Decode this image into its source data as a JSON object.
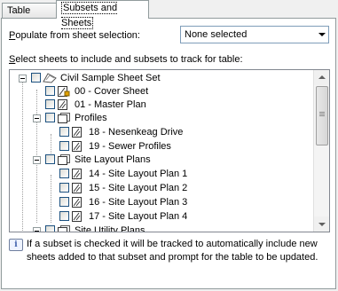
{
  "tabs": [
    {
      "label": "Table Data",
      "active": false
    },
    {
      "label": "Subsets and Sheets",
      "active": true
    }
  ],
  "populate": {
    "label_accel": "P",
    "label_rest": "opulate from sheet selection:",
    "value": "None selected"
  },
  "select": {
    "label_accel": "S",
    "label_rest": "elect sheets to include and subsets to track for table:"
  },
  "tree": {
    "root": "Civil Sample Sheet Set",
    "items": [
      {
        "label": "00 - Cover Sheet"
      },
      {
        "label": "01 - Master Plan"
      },
      {
        "label": "Profiles"
      },
      {
        "label": "18 - Nesenkeag Drive"
      },
      {
        "label": "19 - Sewer Profiles"
      },
      {
        "label": "Site Layout Plans"
      },
      {
        "label": "14 - Site Layout Plan 1"
      },
      {
        "label": "15 - Site Layout Plan 2"
      },
      {
        "label": "16 - Site Layout Plan 3"
      },
      {
        "label": "17 - Site Layout Plan 4"
      },
      {
        "label": "Site Utility Plans"
      }
    ]
  },
  "info": {
    "icon": "i",
    "text": "If a subset is checked it will be tracked to automatically include new sheets added to that subset and prompt for the table to be updated."
  }
}
